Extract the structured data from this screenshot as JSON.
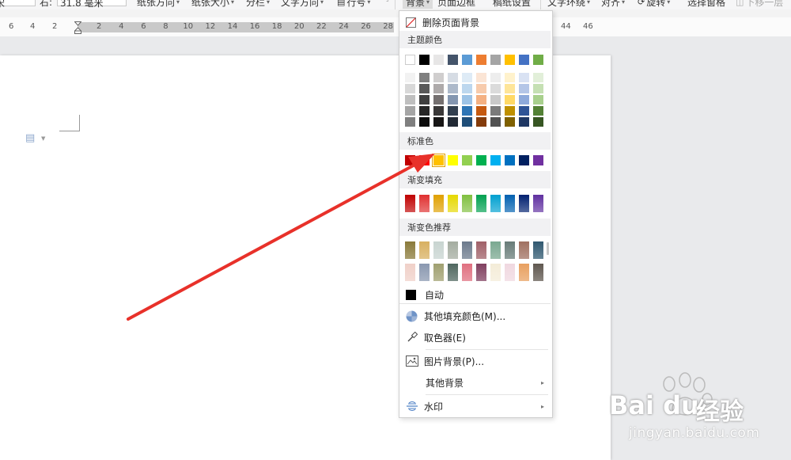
{
  "toolbar": {
    "font_tail": "宋",
    "size_label": "右:",
    "size_value": "31.8 毫米",
    "orientation": "纸张方向",
    "paper_size": "纸张大小",
    "columns": "分栏",
    "text_direction": "文字方向",
    "line_number": "行号",
    "background": "背景",
    "page_border": "页面边框",
    "paper_settings": "稿纸设置",
    "text_wrap": "文字环绕",
    "align": "对齐",
    "rotate": "旋转",
    "selection_pane": "选择窗格",
    "move_down": "下移一层"
  },
  "ruler": {
    "left_ticks": [
      "6",
      "4",
      "2"
    ],
    "right_ticks": [
      "2",
      "4",
      "6",
      "8",
      "10",
      "12",
      "14",
      "16",
      "18",
      "20",
      "22",
      "24",
      "26",
      "28"
    ],
    "far_ticks": [
      "44",
      "46"
    ]
  },
  "menu": {
    "remove_background": "删除页面背景",
    "theme_colors_title": "主题颜色",
    "theme_top_row": [
      "#ffffff",
      "#000000",
      "#e7e6e6",
      "#44546a",
      "#5b9bd5",
      "#ed7d31",
      "#a5a5a5",
      "#ffc000",
      "#4472c4",
      "#70ad47"
    ],
    "theme_shades": [
      [
        "#f2f2f2",
        "#7f7f7f",
        "#d0cece",
        "#d6dce4",
        "#deebf6",
        "#fbe5d5",
        "#ededed",
        "#fff2cc",
        "#d9e2f3",
        "#e2efd9"
      ],
      [
        "#d8d8d8",
        "#595959",
        "#aeaaaa",
        "#adb9ca",
        "#bdd7ee",
        "#f7cbac",
        "#dbdbdb",
        "#fee599",
        "#b4c6e7",
        "#c5e0b3"
      ],
      [
        "#bfbfbf",
        "#3f3f3f",
        "#757070",
        "#8496b0",
        "#9dc3e6",
        "#f4b183",
        "#c9c9c9",
        "#ffd966",
        "#8eaadb",
        "#a8d08d"
      ],
      [
        "#a5a5a5",
        "#262626",
        "#3a3838",
        "#323f4f",
        "#2e75b5",
        "#c55a11",
        "#7b7b7b",
        "#bf9000",
        "#2f5496",
        "#538135"
      ],
      [
        "#7f7f7f",
        "#0c0c0c",
        "#171616",
        "#222a35",
        "#1f4e79",
        "#843c0b",
        "#525252",
        "#7f6000",
        "#1f3864",
        "#375623"
      ]
    ],
    "standard_title": "标准色",
    "standard_colors": [
      "#c00000",
      "#ff0000",
      "#ffc000",
      "#ffff00",
      "#92d050",
      "#00b050",
      "#00b0f0",
      "#0070c0",
      "#002060",
      "#7030a0"
    ],
    "gradient_fill_title": "渐变填充",
    "gradient_fills": [
      "#c00000",
      "#e03030",
      "#e0a000",
      "#e6d800",
      "#80c040",
      "#00a050",
      "#00a0d0",
      "#0060b0",
      "#002070",
      "#6030a0"
    ],
    "gradient_recommend_title": "渐变色推荐",
    "gradient_recommend_row1": [
      "#8a7a3a",
      "#d8b060",
      "#c8d4d0",
      "#a4aca0",
      "#6c7a8c",
      "#a06068",
      "#7aa890",
      "#687c78",
      "#a07060",
      "#305870"
    ],
    "gradient_recommend_row2": [
      "#f0d0c8",
      "#8a98b0",
      "#a0a070",
      "#506860",
      "#e07080",
      "#804060",
      "#f4ecd8",
      "#f0d8e0",
      "#e8a060",
      "#605850"
    ],
    "auto_label": "自动",
    "more_fill_colors": "其他填充颜色(M)...",
    "color_picker": "取色器(E)",
    "picture_background": "图片背景(P)...",
    "other_background": "其他背景",
    "watermark": "水印"
  },
  "watermark_brand": {
    "logo": "Bai du",
    "cn": "经验",
    "url": "jingyan.baidu.com"
  }
}
